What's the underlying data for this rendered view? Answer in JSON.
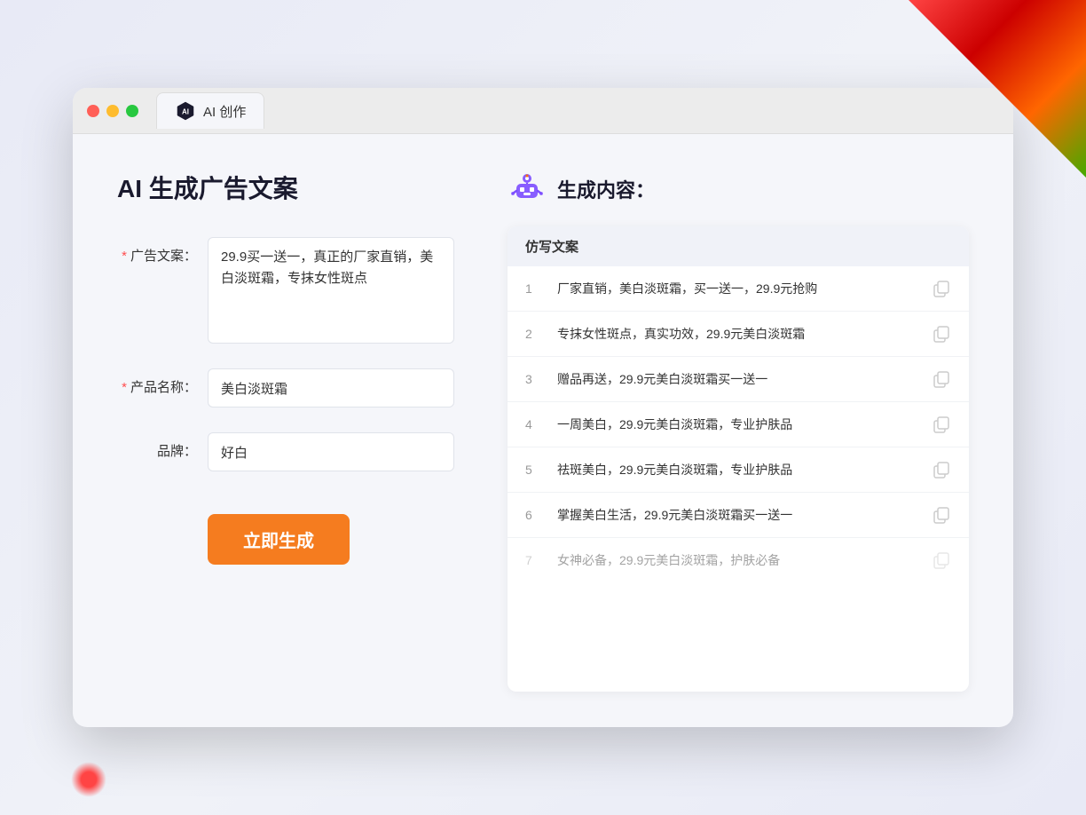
{
  "window": {
    "tab_label": "AI 创作"
  },
  "page": {
    "title": "AI 生成广告文案",
    "result_title": "生成内容："
  },
  "form": {
    "ad_text_label": "广告文案：",
    "ad_text_required": "*",
    "ad_text_value": "29.9买一送一，真正的厂家直销，美白淡斑霜，专抹女性斑点",
    "product_name_label": "产品名称：",
    "product_name_required": "*",
    "product_name_value": "美白淡斑霜",
    "brand_label": "品牌：",
    "brand_value": "好白",
    "generate_button": "立即生成"
  },
  "results": {
    "table_header": "仿写文案",
    "rows": [
      {
        "number": "1",
        "text": "厂家直销，美白淡斑霜，买一送一，29.9元抢购",
        "dimmed": false
      },
      {
        "number": "2",
        "text": "专抹女性斑点，真实功效，29.9元美白淡斑霜",
        "dimmed": false
      },
      {
        "number": "3",
        "text": "赠品再送，29.9元美白淡斑霜买一送一",
        "dimmed": false
      },
      {
        "number": "4",
        "text": "一周美白，29.9元美白淡斑霜，专业护肤品",
        "dimmed": false
      },
      {
        "number": "5",
        "text": "祛斑美白，29.9元美白淡斑霜，专业护肤品",
        "dimmed": false
      },
      {
        "number": "6",
        "text": "掌握美白生活，29.9元美白淡斑霜买一送一",
        "dimmed": false
      },
      {
        "number": "7",
        "text": "女神必备，29.9元美白淡斑霜，护肤必备",
        "dimmed": true
      }
    ]
  },
  "colors": {
    "accent": "#f57c1f",
    "required": "#ff4d4f",
    "text_primary": "#1a1a2e",
    "text_secondary": "#333",
    "text_muted": "#999"
  }
}
